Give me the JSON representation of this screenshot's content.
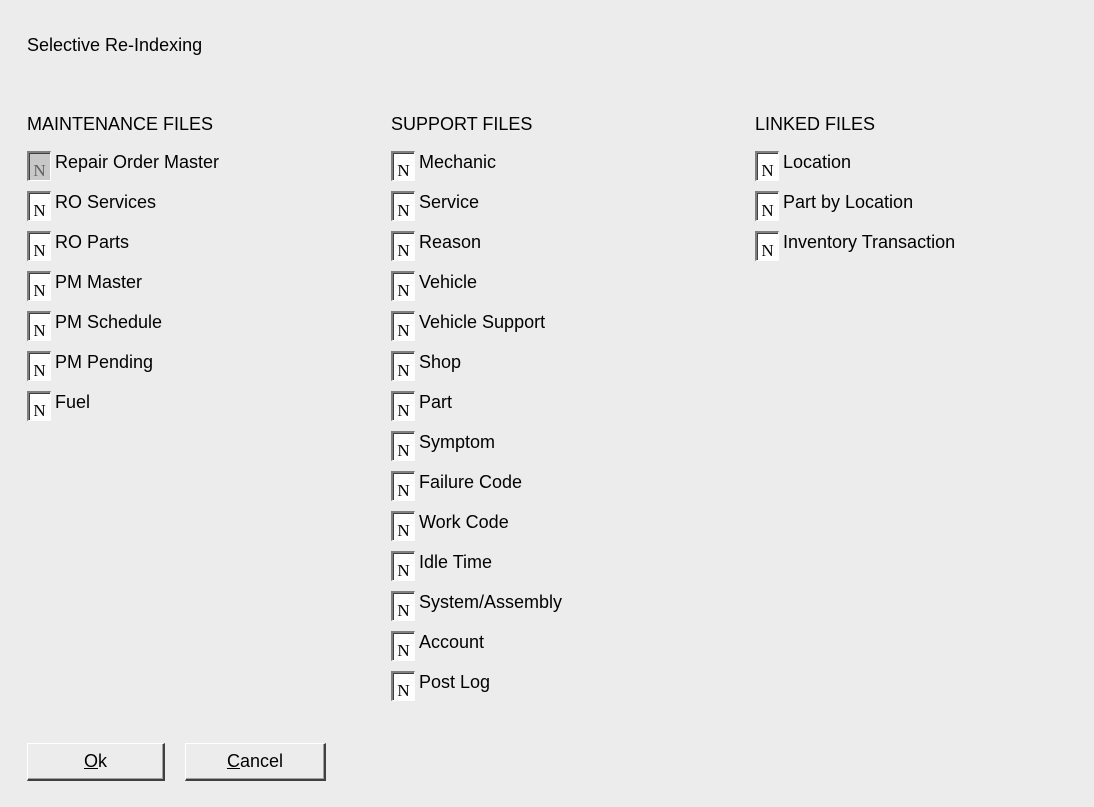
{
  "dialog": {
    "title": "Selective Re-Indexing"
  },
  "maintenance": {
    "heading": "MAINTENANCE FILES",
    "items": [
      {
        "flag": "N",
        "label": "Repair Order Master",
        "focused": true
      },
      {
        "flag": "N",
        "label": "RO Services"
      },
      {
        "flag": "N",
        "label": "RO Parts"
      },
      {
        "flag": "N",
        "label": "PM Master"
      },
      {
        "flag": "N",
        "label": "PM Schedule"
      },
      {
        "flag": "N",
        "label": "PM Pending"
      },
      {
        "flag": "N",
        "label": "Fuel"
      }
    ]
  },
  "support": {
    "heading": "SUPPORT FILES",
    "items": [
      {
        "flag": "N",
        "label": "Mechanic"
      },
      {
        "flag": "N",
        "label": "Service"
      },
      {
        "flag": "N",
        "label": "Reason"
      },
      {
        "flag": "N",
        "label": "Vehicle"
      },
      {
        "flag": "N",
        "label": "Vehicle Support"
      },
      {
        "flag": "N",
        "label": "Shop"
      },
      {
        "flag": "N",
        "label": "Part"
      },
      {
        "flag": "N",
        "label": "Symptom"
      },
      {
        "flag": "N",
        "label": "Failure Code"
      },
      {
        "flag": "N",
        "label": "Work Code"
      },
      {
        "flag": "N",
        "label": "Idle Time"
      },
      {
        "flag": "N",
        "label": "System/Assembly"
      },
      {
        "flag": "N",
        "label": "Account"
      },
      {
        "flag": "N",
        "label": "Post Log"
      }
    ]
  },
  "linked": {
    "heading": "LINKED FILES",
    "items": [
      {
        "flag": "N",
        "label": "Location"
      },
      {
        "flag": "N",
        "label": "Part by Location"
      },
      {
        "flag": "N",
        "label": "Inventory Transaction"
      }
    ]
  },
  "buttons": {
    "ok": {
      "mnemonic": "O",
      "rest": "k"
    },
    "cancel": {
      "mnemonic": "C",
      "rest": "ancel"
    }
  }
}
